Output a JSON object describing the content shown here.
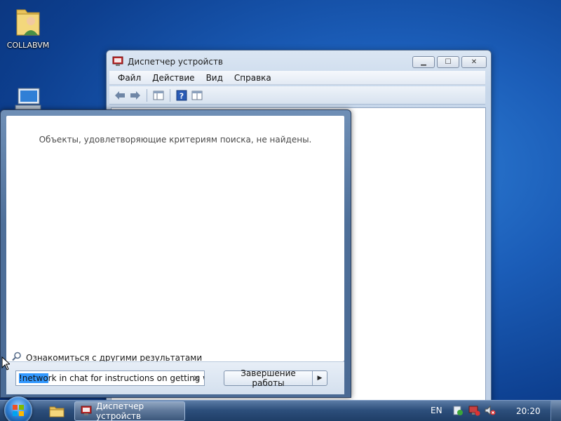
{
  "desktop": {
    "icons": [
      {
        "label": "COLLABVM",
        "icon": "folder-user-icon"
      },
      {
        "label": "",
        "icon": "computer-icon"
      }
    ]
  },
  "device_manager": {
    "title": "Диспетчер устройств",
    "menu": [
      "Файл",
      "Действие",
      "Вид",
      "Справка"
    ],
    "toolbar": [
      "back-arrow-icon",
      "forward-arrow-icon",
      "console-tree-icon",
      "help-icon",
      "properties-icon"
    ],
    "caption_buttons": {
      "minimize": "▁",
      "maximize": "☐",
      "close": "✕"
    }
  },
  "start_menu": {
    "no_results_text": "Объекты, удовлетворяющие критериям поиска, не найдены.",
    "see_more_results": "Ознакомиться с другими результатами",
    "search": {
      "selected_text": "!netwo",
      "value": "rk in chat for instructions on getting wi",
      "clear": "✕"
    },
    "shutdown_label": "Завершение работы",
    "shutdown_arrow": "▶"
  },
  "taskbar": {
    "active_task": "Диспетчер устройств",
    "language": "EN",
    "clock": "20:20",
    "tray_icons": [
      "action-center-icon",
      "network-icon",
      "volume-muted-icon"
    ]
  }
}
